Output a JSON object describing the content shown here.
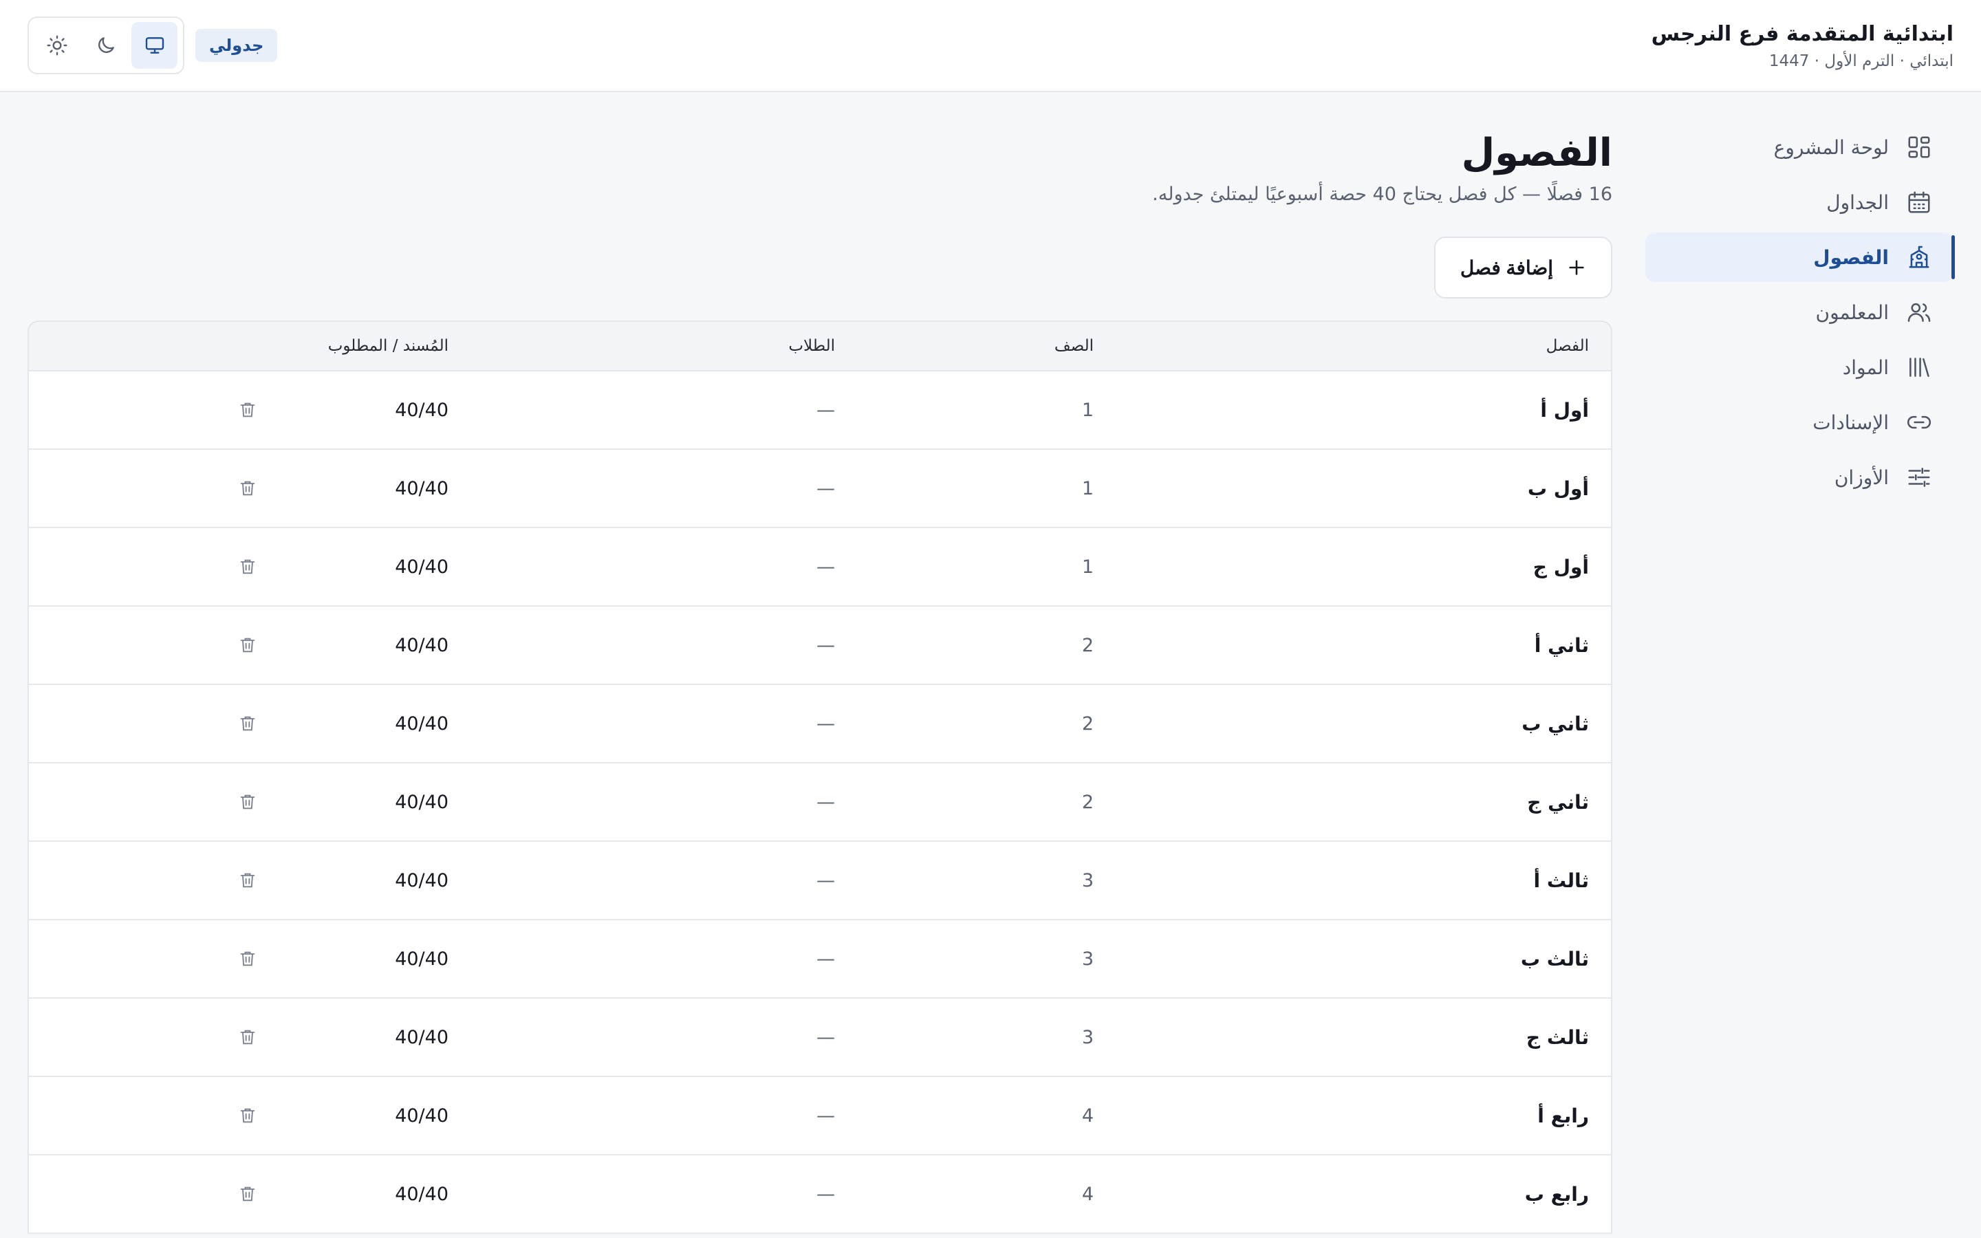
{
  "header": {
    "school_name": "ابتدائية المتقدمة فرع النرجس",
    "term_info": "ابتدائي · الترم الأول · 1447",
    "app_badge": "جدولي"
  },
  "sidebar": {
    "items": [
      {
        "label": "لوحة المشروع",
        "icon": "dashboard-icon"
      },
      {
        "label": "الجداول",
        "icon": "calendar-icon"
      },
      {
        "label": "الفصول",
        "icon": "school-icon",
        "active": true
      },
      {
        "label": "المعلمون",
        "icon": "users-icon"
      },
      {
        "label": "المواد",
        "icon": "library-icon"
      },
      {
        "label": "الإسنادات",
        "icon": "link-icon"
      },
      {
        "label": "الأوزان",
        "icon": "sliders-icon"
      }
    ]
  },
  "main": {
    "title": "الفصول",
    "subtitle": "16 فصلًا — كل فصل يحتاج 40 حصة أسبوعيًا ليمتلئ جدوله.",
    "add_button": "إضافة فصل",
    "table": {
      "headers": {
        "name": "الفصل",
        "grade": "الصف",
        "students": "الطلاب",
        "ratio": "المُسند / المطلوب"
      },
      "rows": [
        {
          "name": "أول أ",
          "grade": "1",
          "students": "—",
          "ratio": "40/40"
        },
        {
          "name": "أول ب",
          "grade": "1",
          "students": "—",
          "ratio": "40/40"
        },
        {
          "name": "أول ج",
          "grade": "1",
          "students": "—",
          "ratio": "40/40"
        },
        {
          "name": "ثاني أ",
          "grade": "2",
          "students": "—",
          "ratio": "40/40"
        },
        {
          "name": "ثاني ب",
          "grade": "2",
          "students": "—",
          "ratio": "40/40"
        },
        {
          "name": "ثاني ج",
          "grade": "2",
          "students": "—",
          "ratio": "40/40"
        },
        {
          "name": "ثالث أ",
          "grade": "3",
          "students": "—",
          "ratio": "40/40"
        },
        {
          "name": "ثالث ب",
          "grade": "3",
          "students": "—",
          "ratio": "40/40"
        },
        {
          "name": "ثالث ج",
          "grade": "3",
          "students": "—",
          "ratio": "40/40"
        },
        {
          "name": "رابع أ",
          "grade": "4",
          "students": "—",
          "ratio": "40/40"
        },
        {
          "name": "رابع ب",
          "grade": "4",
          "students": "—",
          "ratio": "40/40"
        }
      ]
    }
  },
  "colors": {
    "accent": "#1d4e95",
    "accent_bg": "#eaf0fb",
    "page_bg": "#f6f7f9"
  }
}
